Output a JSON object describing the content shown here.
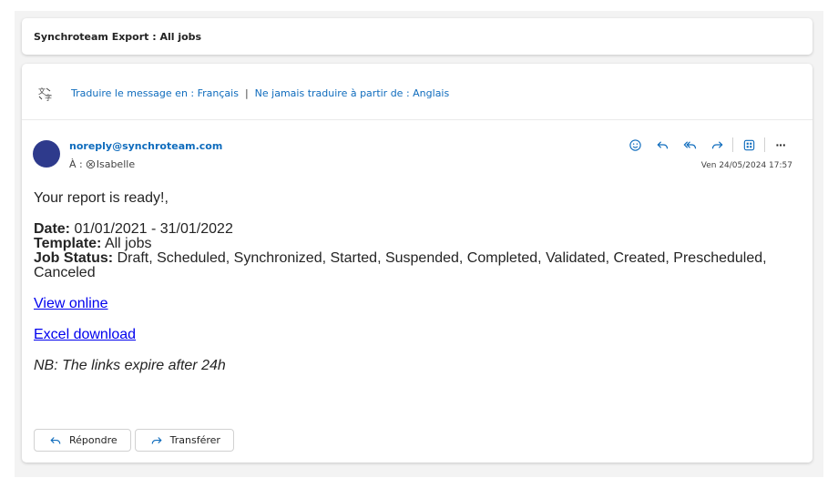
{
  "subject": "Synchroteam Export : All jobs",
  "translate_bar": {
    "translate_link": "Traduire le message en : Français",
    "separator": "|",
    "never_translate_link": "Ne jamais traduire à partir de : Anglais"
  },
  "header": {
    "sender": "noreply@synchroteam.com",
    "to_prefix": "À :",
    "recipient": "Isabelle",
    "date": "Ven 24/05/2024 17:57",
    "avatar_color": "#2e3a8c"
  },
  "actions": [
    "emoji-icon",
    "reply-icon",
    "reply-all-icon",
    "forward-icon",
    "apps-icon",
    "more-icon"
  ],
  "more_label": "···",
  "body": {
    "greeting": "Your report is ready!,",
    "date_label": "Date:",
    "date_value": " 01/01/2021 - 31/01/2022",
    "template_label": "Template:",
    "template_value": " All jobs",
    "status_label": "Job Status:",
    "status_value": " Draft, Scheduled, Synchronized, Started, Suspended, Completed, Validated, Created, Prescheduled, Canceled",
    "view_online": "View online",
    "excel_download": "Excel download",
    "note": "NB: The links expire after 24h"
  },
  "buttons": {
    "reply": "Répondre",
    "forward": "Transférer"
  },
  "colors": {
    "accent": "#0f6cbd",
    "link": "#0000ee"
  }
}
